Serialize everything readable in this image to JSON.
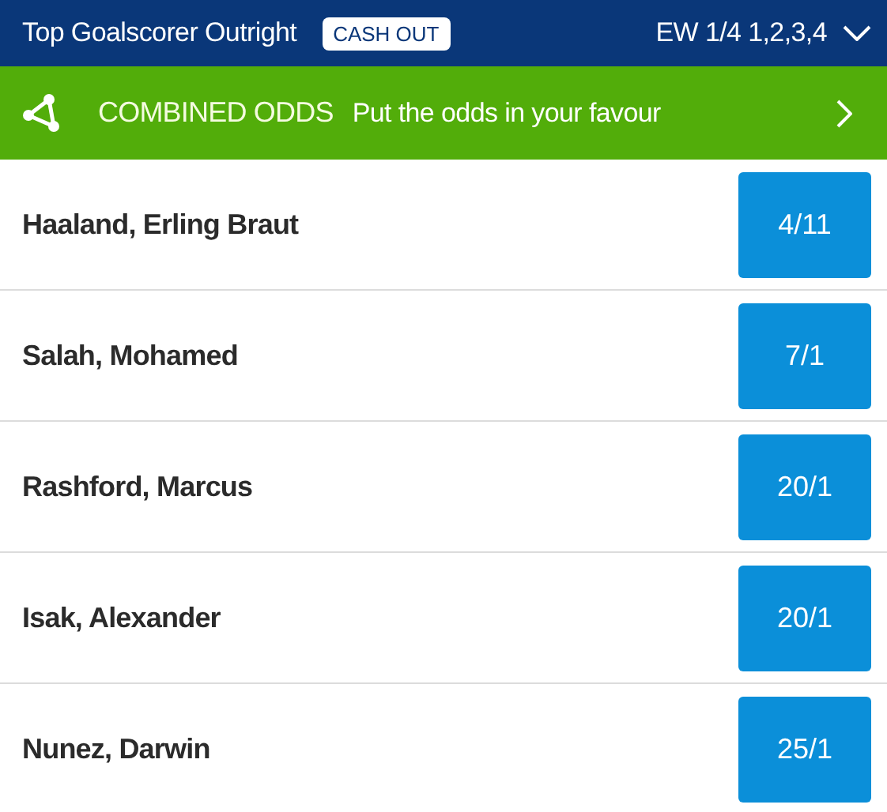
{
  "header": {
    "title": "Top Goalscorer Outright",
    "badge": "CASH OUT",
    "each_way": "EW 1/4 1,2,3,4"
  },
  "promo": {
    "title": "COMBINED ODDS",
    "subtitle": "Put the odds in your favour"
  },
  "selections": [
    {
      "name": "Haaland, Erling Braut",
      "odds": "4/11"
    },
    {
      "name": "Salah, Mohamed",
      "odds": "7/1"
    },
    {
      "name": "Rashford, Marcus",
      "odds": "20/1"
    },
    {
      "name": "Isak, Alexander",
      "odds": "20/1"
    },
    {
      "name": "Nunez, Darwin",
      "odds": "25/1"
    }
  ]
}
